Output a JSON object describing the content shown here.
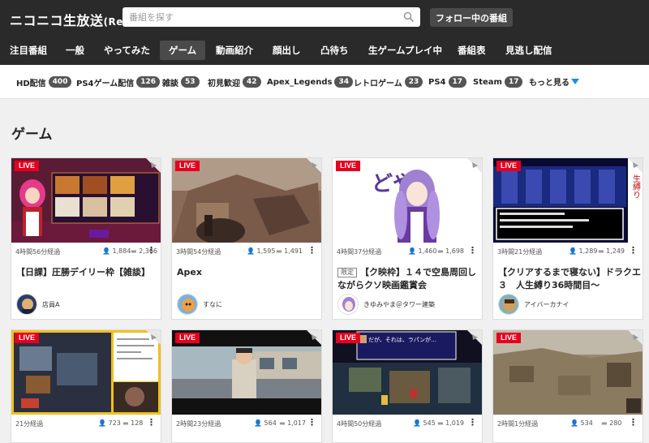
{
  "header": {
    "logo_text": "ニコニコ生放送",
    "logo_suffix": "(Re)",
    "search_placeholder": "番組を探す",
    "follow_button": "フォロー中の番組"
  },
  "nav": {
    "tabs": [
      {
        "label": "注目番組"
      },
      {
        "label": "一般"
      },
      {
        "label": "やってみた"
      },
      {
        "label": "ゲーム",
        "active": true
      },
      {
        "label": "動画紹介"
      },
      {
        "label": "顔出し"
      },
      {
        "label": "凸待ち"
      },
      {
        "label": "生ゲームプレイ中"
      },
      {
        "label": "番組表"
      },
      {
        "label": "見逃し配信"
      }
    ]
  },
  "tags": {
    "items": [
      {
        "label": "HD配信",
        "count": "400"
      },
      {
        "label": "PS4ゲーム配信",
        "count": "126"
      },
      {
        "label": "雑談",
        "count": "53"
      },
      {
        "label": "初見歓迎",
        "count": "42"
      },
      {
        "label": "Apex_Legends",
        "count": "34"
      },
      {
        "label": "レトロゲーム",
        "count": "23"
      },
      {
        "label": "PS4",
        "count": "17"
      },
      {
        "label": "Steam",
        "count": "17"
      }
    ],
    "more_label": "もっと見る"
  },
  "section": {
    "title": "ゲーム"
  },
  "live_label": "LIVE",
  "cards": [
    {
      "elapsed": "4時間56分経過",
      "views": "1,884",
      "comments": "2,366",
      "title": "【日課】圧勝デイリー枠【雑談】",
      "owner": "店員A",
      "limited": ""
    },
    {
      "elapsed": "3時間54分経過",
      "views": "1,595",
      "comments": "1,491",
      "title": "Apex",
      "owner": "すなに",
      "limited": ""
    },
    {
      "elapsed": "4時間37分経過",
      "views": "1,460",
      "comments": "1,698",
      "title": "【ク映枠】１４で空島周回しながらクソ映画鑑賞会",
      "owner": "きゆみやま＠タワー建築",
      "limited": "限定"
    },
    {
      "elapsed": "3時間21分経過",
      "views": "1,289",
      "comments": "1,249",
      "title": "【クリアするまで寝ない】ドラクエ３　人生縛り36時間目〜",
      "owner": "アイバーカナイ",
      "limited": ""
    },
    {
      "elapsed": "21分経過",
      "views": "723",
      "comments": "128",
      "title": "",
      "owner": "",
      "limited": ""
    },
    {
      "elapsed": "2時間23分経過",
      "views": "564",
      "comments": "1,017",
      "title": "",
      "owner": "",
      "limited": ""
    },
    {
      "elapsed": "4時間50分経過",
      "views": "545",
      "comments": "1,019",
      "title": "",
      "owner": "",
      "limited": ""
    },
    {
      "elapsed": "2時間1分経過",
      "views": "534",
      "comments": "280",
      "title": "",
      "owner": "",
      "limited": ""
    }
  ],
  "thumb_texts": {
    "card3": "どや",
    "card4": "生縛り",
    "card7": "だが、それは、ラパンが…"
  }
}
